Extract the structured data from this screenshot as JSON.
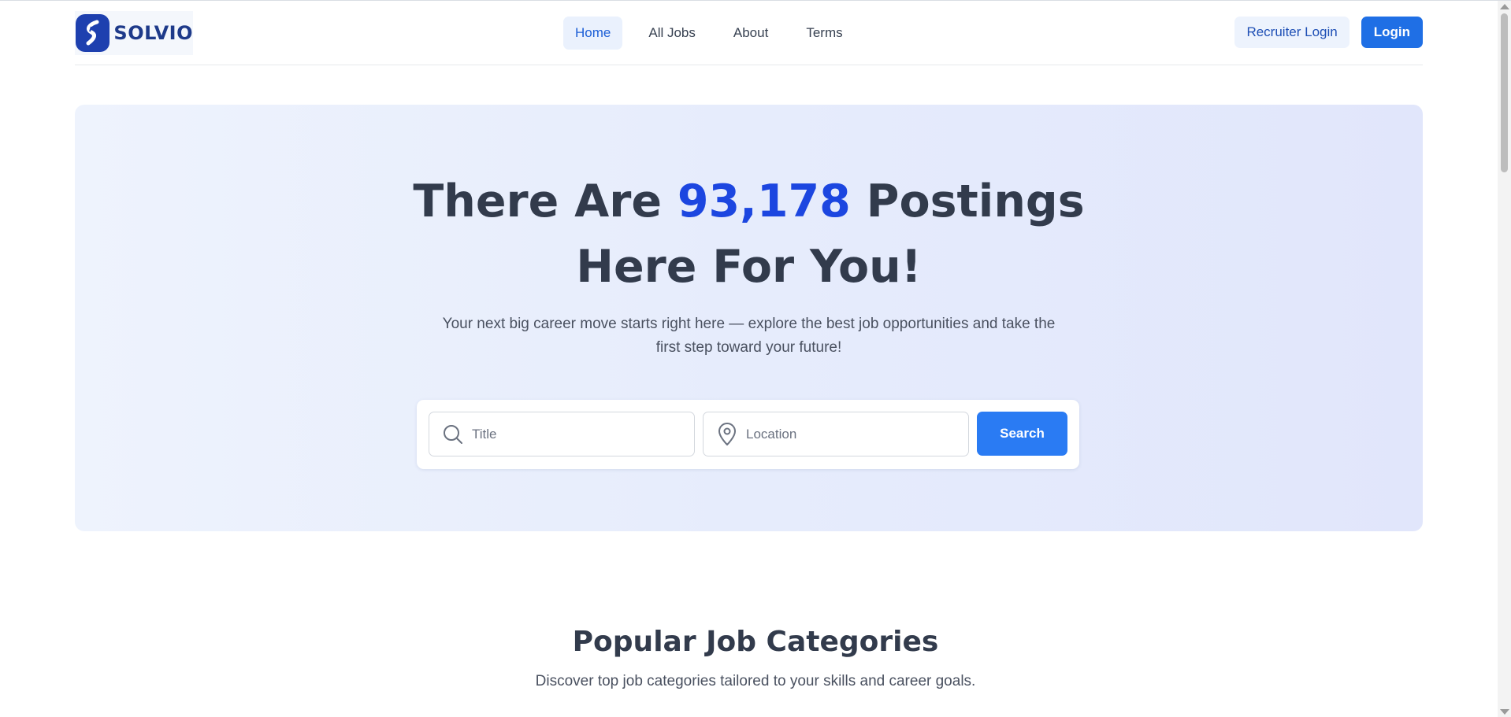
{
  "header": {
    "logo_text": "SOLVIO",
    "nav": [
      {
        "label": "Home",
        "active": true
      },
      {
        "label": "All Jobs",
        "active": false
      },
      {
        "label": "About",
        "active": false
      },
      {
        "label": "Terms",
        "active": false
      }
    ],
    "recruiter_login_label": "Recruiter Login",
    "login_label": "Login"
  },
  "hero": {
    "title_before": "There Are",
    "title_count": "93,178",
    "title_after_line1": "Postings",
    "title_line2": "Here For You!",
    "subtitle_line1": "Your next big career move starts right here — explore the best job opportunities and take the",
    "subtitle_line2": "first step toward your future!",
    "search": {
      "title_placeholder": "Title",
      "title_value": "",
      "location_placeholder": "Location",
      "location_value": "",
      "button_label": "Search"
    }
  },
  "categories": {
    "title": "Popular Job Categories",
    "subtitle": "Discover top job categories tailored to your skills and career goals."
  },
  "icons": {
    "logo": "solvio-logo-icon",
    "title_search": "search-icon",
    "location": "map-pin-icon"
  },
  "colors": {
    "accent": "#1f6fe5",
    "highlight": "#1c46e0",
    "logo": "#1e40af",
    "heading": "#323b4c",
    "active_nav_bg": "#eaf1fd"
  }
}
